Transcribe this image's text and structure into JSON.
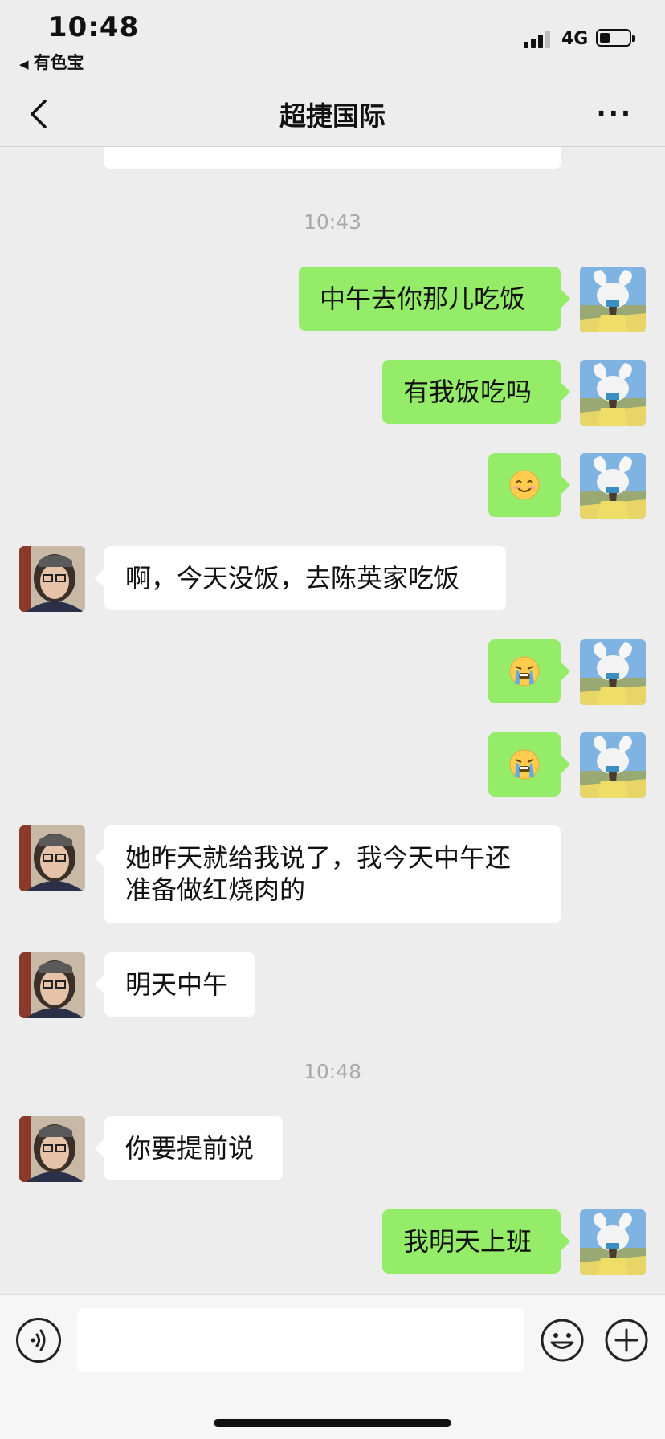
{
  "status_bar": {
    "time": "10:48",
    "back_app": "有色宝",
    "network": "4G"
  },
  "header": {
    "title": "超捷国际"
  },
  "messages": [
    {
      "type": "time",
      "text": "10:43"
    },
    {
      "type": "msg",
      "side": "me",
      "text": "中午去你那儿吃饭"
    },
    {
      "type": "msg",
      "side": "me",
      "text": "有我饭吃吗"
    },
    {
      "type": "msg",
      "side": "me",
      "emoji": "smile",
      "text": "😊"
    },
    {
      "type": "msg",
      "side": "them",
      "text": "啊，今天没饭，去陈英家吃饭"
    },
    {
      "type": "msg",
      "side": "me",
      "emoji": "cry",
      "text": "😭"
    },
    {
      "type": "msg",
      "side": "me",
      "emoji": "cry",
      "text": "😭"
    },
    {
      "type": "msg",
      "side": "them",
      "lines": [
        "她昨天就给我说了，我今天中午还",
        "准备做红烧肉的"
      ]
    },
    {
      "type": "msg",
      "side": "them",
      "text": "明天中午"
    },
    {
      "type": "time",
      "text": "10:48"
    },
    {
      "type": "msg",
      "side": "them",
      "text": "你要提前说"
    },
    {
      "type": "msg",
      "side": "me",
      "text": "我明天上班"
    }
  ],
  "input": {
    "value": "",
    "placeholder": ""
  },
  "icons": {
    "back": "chevron-left-icon",
    "more": "more-dots-icon",
    "voice": "voice-icon",
    "emoji": "emoji-face-icon",
    "plus": "plus-icon"
  },
  "colors": {
    "my_bubble": "#95ec69",
    "their_bubble": "#ffffff",
    "background": "#ededed"
  }
}
